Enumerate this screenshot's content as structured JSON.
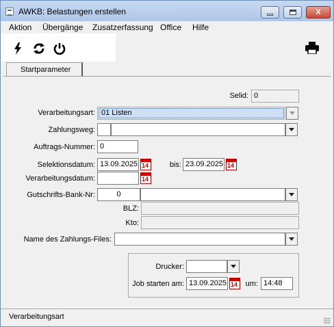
{
  "window": {
    "title": "AWKB: Belastungen erstellen",
    "close_glyph": "X"
  },
  "menu": [
    "Aktion",
    "Übergänge",
    "Zusatzerfassung",
    "Office",
    "Hilfe"
  ],
  "toolbar_icons": [
    "lightning-icon",
    "refresh-icon",
    "power-icon",
    "printer-icon"
  ],
  "tabs": [
    {
      "label": "Startparameter",
      "active": true
    }
  ],
  "form": {
    "selid": {
      "label": "Selid:",
      "value": "0"
    },
    "verarbeitungsart": {
      "label": "Verarbeitungsart:",
      "value": "01  Listen"
    },
    "zahlungsweg": {
      "label": "Zahlungsweg:",
      "code": "",
      "text": ""
    },
    "auftrags_nummer": {
      "label": "Auftrags-Nummer:",
      "value": "0"
    },
    "selektionsdatum": {
      "label": "Selektionsdatum:",
      "from": "13.09.2025",
      "bis_label": "bis:",
      "to": "23.09.2025"
    },
    "verarbeitungsdatum": {
      "label": "Verarbeitungsdatum:",
      "value": ""
    },
    "gutschrifts_bank_nr": {
      "label": "Gutschrifts-Bank-Nr:",
      "value": "0",
      "text": ""
    },
    "blz": {
      "label": "BLZ:",
      "value": ""
    },
    "kto": {
      "label": "Kto:",
      "value": ""
    },
    "zahlungsfile": {
      "label": "Name des Zahlungs-Files:",
      "value": ""
    },
    "calendar_glyph": "14"
  },
  "job": {
    "drucker": {
      "label": "Drucker:",
      "value": ""
    },
    "job_starten": {
      "label": "Job starten am:",
      "date": "13.09.2025",
      "um_label": "um:",
      "time": "14:48"
    }
  },
  "status": {
    "text": "Verarbeitungsart"
  }
}
